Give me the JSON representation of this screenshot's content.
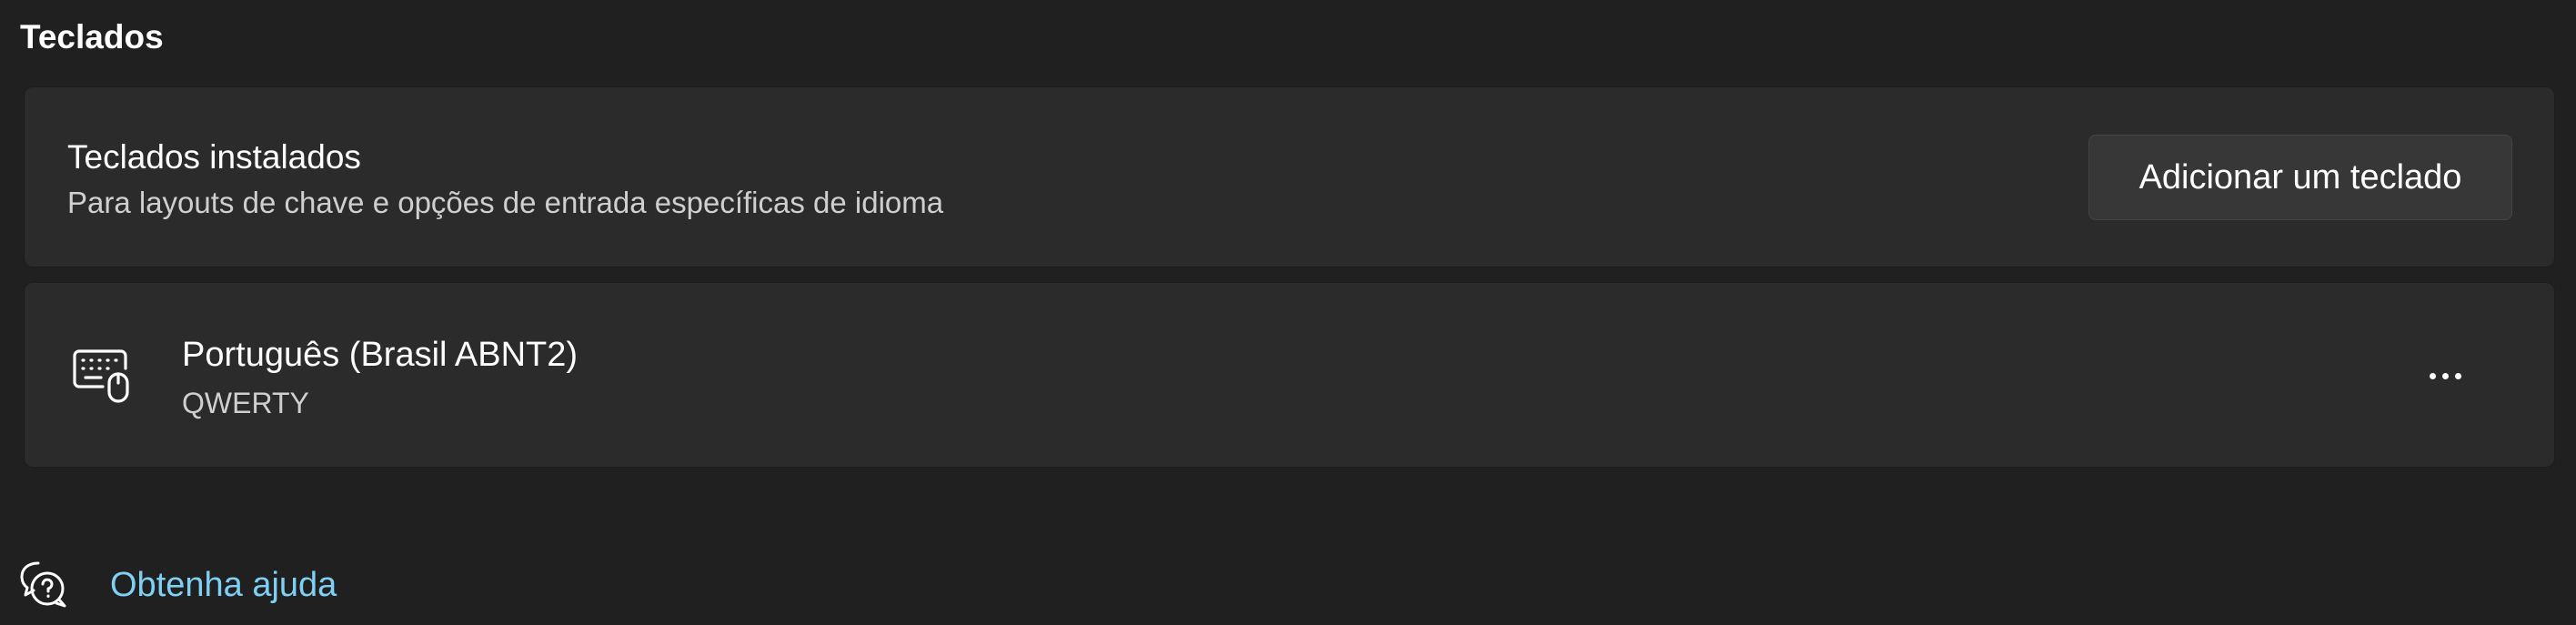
{
  "section": {
    "title": "Teclados"
  },
  "installed": {
    "title": "Teclados instalados",
    "description": "Para layouts de chave e opções de entrada específicas de idioma",
    "add_button_label": "Adicionar um teclado"
  },
  "keyboards": [
    {
      "name": "Português (Brasil ABNT2)",
      "layout": "QWERTY",
      "icon": "keyboard-mouse-icon"
    }
  ],
  "help": {
    "link_label": "Obtenha ajuda",
    "icon": "help-chat-icon"
  },
  "colors": {
    "background": "#202020",
    "card": "#2b2b2b",
    "link": "#7fd0f5"
  }
}
